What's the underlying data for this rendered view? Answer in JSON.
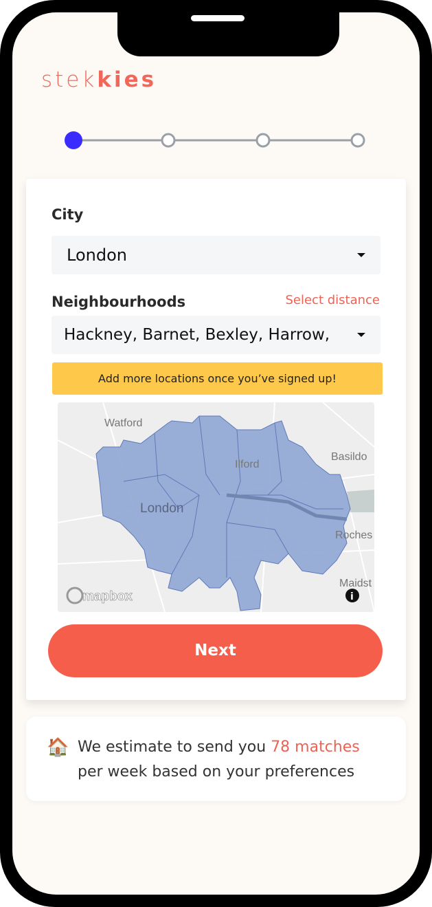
{
  "logo": {
    "light": "stek",
    "bold": "kies"
  },
  "stepper": {
    "total_steps": 4,
    "current_step": 1,
    "active_color": "#3a2bff"
  },
  "form": {
    "city_label": "City",
    "city_value": "London",
    "neighbourhoods_label": "Neighbourhoods",
    "select_distance": "Select distance",
    "neighbourhoods_value": "Hackney, Barnet, Bexley, Harrow,",
    "banner": "Add more locations once you’ve signed up!",
    "next_label": "Next"
  },
  "map": {
    "labels": [
      "Watford",
      "Ilford",
      "Basildo",
      "London",
      "Roches",
      "Maidst"
    ],
    "attribution": "mapbox",
    "region_color": "#8fa6d4"
  },
  "estimate": {
    "icon": "house-emoji",
    "emoji": "🏠",
    "prefix": "We estimate to send you ",
    "highlight": "78 matches",
    "suffix": "per week based on your preferences"
  },
  "colors": {
    "accent": "#f45e4a",
    "banner": "#fec94a",
    "background": "#fdfaf5"
  }
}
